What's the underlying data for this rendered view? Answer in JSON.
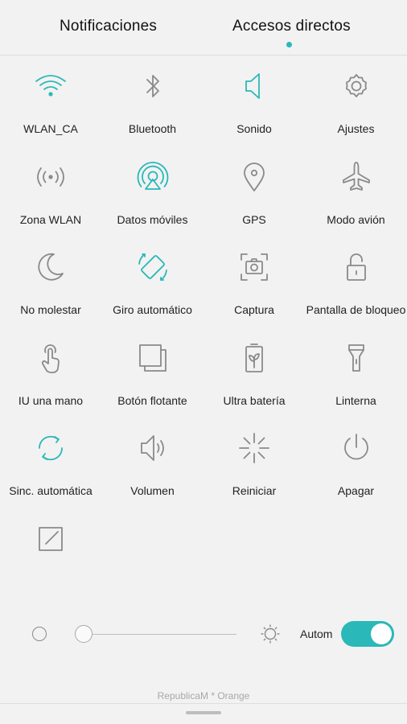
{
  "tabs": {
    "notifications": "Notificaciones",
    "shortcuts": "Accesos directos"
  },
  "tiles": [
    {
      "label": "WLAN_CA",
      "icon": "wifi-icon",
      "active": true
    },
    {
      "label": "Bluetooth",
      "icon": "bluetooth-icon",
      "active": false
    },
    {
      "label": "Sonido",
      "icon": "speaker-icon",
      "active": true
    },
    {
      "label": "Ajustes",
      "icon": "gear-icon",
      "active": false
    },
    {
      "label": "Zona WLAN",
      "icon": "hotspot-icon",
      "active": false
    },
    {
      "label": "Datos móviles",
      "icon": "mobile-data-icon",
      "active": true
    },
    {
      "label": "GPS",
      "icon": "location-pin-icon",
      "active": false
    },
    {
      "label": "Modo avión",
      "icon": "airplane-icon",
      "active": false
    },
    {
      "label": "No molestar",
      "icon": "moon-icon",
      "active": false
    },
    {
      "label": "Giro automático",
      "icon": "auto-rotate-icon",
      "active": true
    },
    {
      "label": "Captura",
      "icon": "screenshot-camera-icon",
      "active": false
    },
    {
      "label": "Pantalla de bloqueo",
      "icon": "unlocked-padlock-icon",
      "active": false
    },
    {
      "label": "IU una mano",
      "icon": "one-hand-icon",
      "active": false
    },
    {
      "label": "Botón flotante",
      "icon": "floating-button-icon",
      "active": false
    },
    {
      "label": "Ultra batería",
      "icon": "battery-icon",
      "active": false
    },
    {
      "label": "Linterna",
      "icon": "flashlight-icon",
      "active": false
    },
    {
      "label": "Sinc. automática",
      "icon": "sync-icon",
      "active": true
    },
    {
      "label": "Volumen",
      "icon": "volume-icon",
      "active": false
    },
    {
      "label": "Reiniciar",
      "icon": "restart-icon",
      "active": false
    },
    {
      "label": "Apagar",
      "icon": "power-icon",
      "active": false
    },
    {
      "label": "",
      "icon": "edit-icon",
      "active": false
    }
  ],
  "brightness": {
    "level": 0.0,
    "auto_label": "Autom",
    "auto_on": true
  },
  "carrier": "RepublicaM * Orange",
  "colors": {
    "accent": "#2ab8b8",
    "inactive": "#8a8a8a",
    "background": "#f2f2f2"
  }
}
